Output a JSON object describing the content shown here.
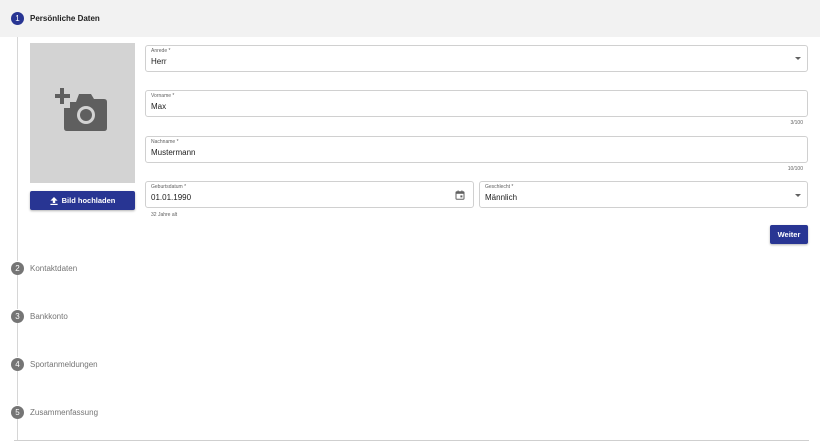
{
  "stepper": {
    "steps": [
      {
        "number": "1",
        "label": "Persönliche Daten",
        "state": "active"
      },
      {
        "number": "2",
        "label": "Kontaktdaten",
        "state": "inactive"
      },
      {
        "number": "3",
        "label": "Bankkonto",
        "state": "inactive"
      },
      {
        "number": "4",
        "label": "Sportanmeldungen",
        "state": "inactive"
      },
      {
        "number": "5",
        "label": "Zusammenfassung",
        "state": "inactive"
      }
    ]
  },
  "photo": {
    "icon": "add-a-photo-icon",
    "upload_label": "Bild hochladen",
    "upload_icon": "upload-icon"
  },
  "form": {
    "salutation": {
      "label": "Anrede *",
      "value": "Herr"
    },
    "first_name": {
      "label": "Vorname *",
      "value": "Max",
      "counter": "3/100"
    },
    "last_name": {
      "label": "Nachname *",
      "value": "Mustermann",
      "counter": "10/100"
    },
    "birthdate": {
      "label": "Geburtsdatum *",
      "value": "01.01.1990",
      "hint": "32 Jahre alt",
      "icon": "calendar-icon"
    },
    "gender": {
      "label": "Geschlecht *",
      "value": "Männlich"
    }
  },
  "actions": {
    "next_label": "Weiter"
  },
  "colors": {
    "primary": "#283593",
    "header_bg": "#f2f2f2",
    "photo_bg": "#d3d3d3",
    "inactive_step": "#757575"
  }
}
